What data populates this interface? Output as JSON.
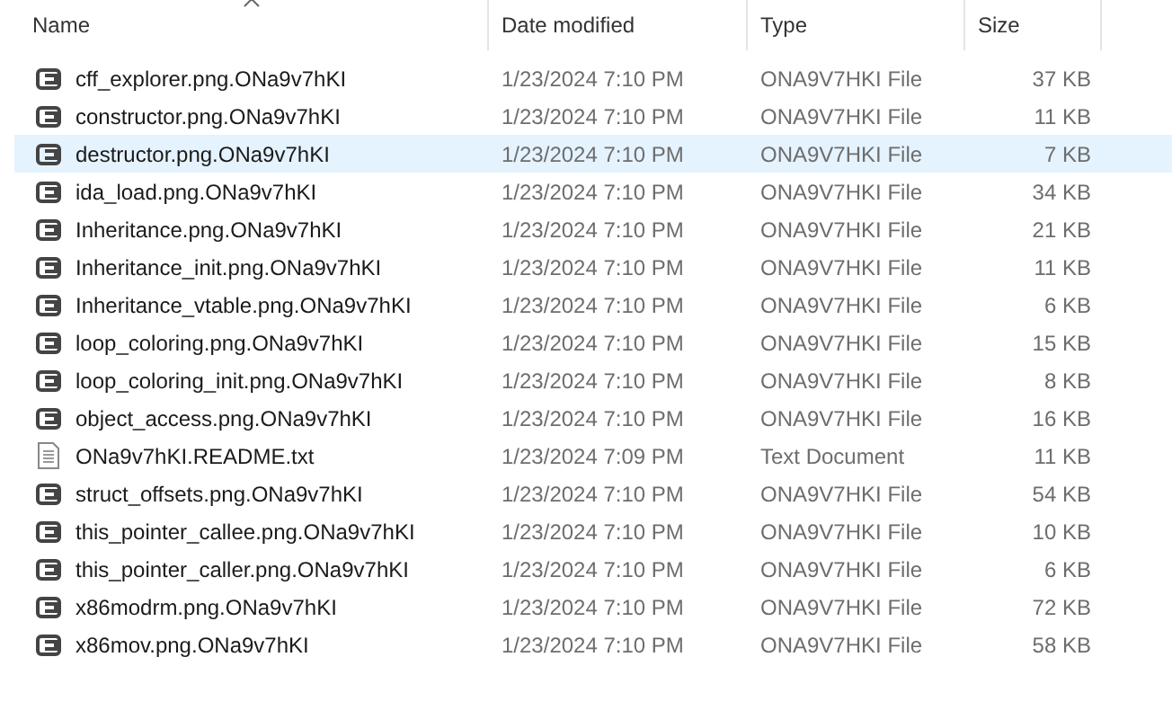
{
  "columns": [
    {
      "label": "Name",
      "sorted": true
    },
    {
      "label": "Date modified",
      "sorted": false
    },
    {
      "label": "Type",
      "sorted": false
    },
    {
      "label": "Size",
      "sorted": false
    }
  ],
  "rows": [
    {
      "name": "cff_explorer.png.ONa9v7hKI",
      "date": "1/23/2024 7:10 PM",
      "type": "ONA9V7HKI File",
      "size": "37 KB",
      "kind": "file",
      "selected": false
    },
    {
      "name": "constructor.png.ONa9v7hKI",
      "date": "1/23/2024 7:10 PM",
      "type": "ONA9V7HKI File",
      "size": "11 KB",
      "kind": "file",
      "selected": false
    },
    {
      "name": "destructor.png.ONa9v7hKI",
      "date": "1/23/2024 7:10 PM",
      "type": "ONA9V7HKI File",
      "size": "7 KB",
      "kind": "file",
      "selected": true
    },
    {
      "name": "ida_load.png.ONa9v7hKI",
      "date": "1/23/2024 7:10 PM",
      "type": "ONA9V7HKI File",
      "size": "34 KB",
      "kind": "file",
      "selected": false
    },
    {
      "name": "Inheritance.png.ONa9v7hKI",
      "date": "1/23/2024 7:10 PM",
      "type": "ONA9V7HKI File",
      "size": "21 KB",
      "kind": "file",
      "selected": false
    },
    {
      "name": "Inheritance_init.png.ONa9v7hKI",
      "date": "1/23/2024 7:10 PM",
      "type": "ONA9V7HKI File",
      "size": "11 KB",
      "kind": "file",
      "selected": false
    },
    {
      "name": "Inheritance_vtable.png.ONa9v7hKI",
      "date": "1/23/2024 7:10 PM",
      "type": "ONA9V7HKI File",
      "size": "6 KB",
      "kind": "file",
      "selected": false
    },
    {
      "name": "loop_coloring.png.ONa9v7hKI",
      "date": "1/23/2024 7:10 PM",
      "type": "ONA9V7HKI File",
      "size": "15 KB",
      "kind": "file",
      "selected": false
    },
    {
      "name": "loop_coloring_init.png.ONa9v7hKI",
      "date": "1/23/2024 7:10 PM",
      "type": "ONA9V7HKI File",
      "size": "8 KB",
      "kind": "file",
      "selected": false
    },
    {
      "name": "object_access.png.ONa9v7hKI",
      "date": "1/23/2024 7:10 PM",
      "type": "ONA9V7HKI File",
      "size": "16 KB",
      "kind": "file",
      "selected": false
    },
    {
      "name": "ONa9v7hKI.README.txt",
      "date": "1/23/2024 7:09 PM",
      "type": "Text Document",
      "size": "11 KB",
      "kind": "text",
      "selected": false
    },
    {
      "name": "struct_offsets.png.ONa9v7hKI",
      "date": "1/23/2024 7:10 PM",
      "type": "ONA9V7HKI File",
      "size": "54 KB",
      "kind": "file",
      "selected": false
    },
    {
      "name": "this_pointer_callee.png.ONa9v7hKI",
      "date": "1/23/2024 7:10 PM",
      "type": "ONA9V7HKI File",
      "size": "10 KB",
      "kind": "file",
      "selected": false
    },
    {
      "name": "this_pointer_caller.png.ONa9v7hKI",
      "date": "1/23/2024 7:10 PM",
      "type": "ONA9V7HKI File",
      "size": "6 KB",
      "kind": "file",
      "selected": false
    },
    {
      "name": "x86modrm.png.ONa9v7hKI",
      "date": "1/23/2024 7:10 PM",
      "type": "ONA9V7HKI File",
      "size": "72 KB",
      "kind": "file",
      "selected": false
    },
    {
      "name": "x86mov.png.ONa9v7hKI",
      "date": "1/23/2024 7:10 PM",
      "type": "ONA9V7HKI File",
      "size": "58 KB",
      "kind": "file",
      "selected": false
    }
  ]
}
